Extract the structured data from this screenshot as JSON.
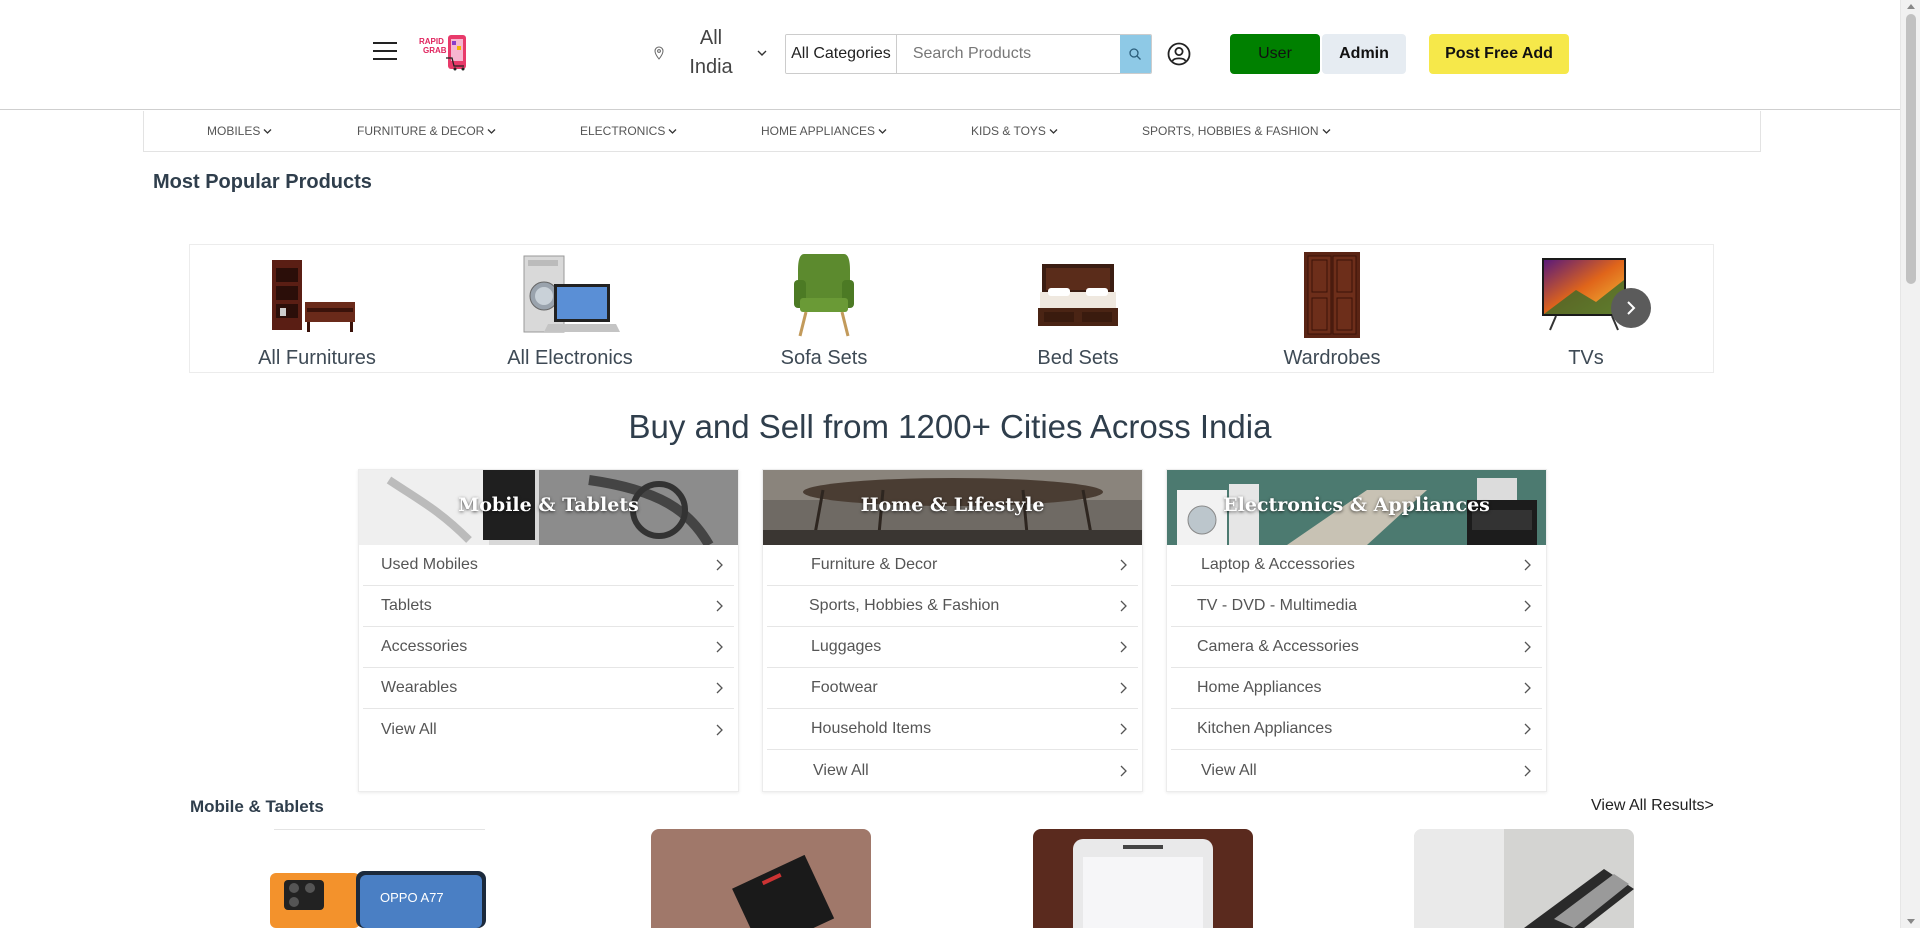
{
  "header": {
    "logo_text_1": "RAPID",
    "logo_text_2": "GRAB",
    "location": "All India",
    "category_select": "All Categories",
    "search_placeholder": "Search Products",
    "user_label": "User",
    "admin_label": "Admin",
    "post_label": "Post Free Add"
  },
  "nav": [
    {
      "label": "MOBILES"
    },
    {
      "label": "FURNITURE & DECOR"
    },
    {
      "label": "ELECTRONICS"
    },
    {
      "label": "HOME APPLIANCES"
    },
    {
      "label": "KIDS & TOYS"
    },
    {
      "label": "SPORTS, HOBBIES & FASHION"
    }
  ],
  "popular": {
    "title": "Most Popular Products",
    "items": [
      {
        "label": "All Furnitures",
        "icon": "furniture-image"
      },
      {
        "label": "All Electronics",
        "icon": "electronics-image"
      },
      {
        "label": "Sofa Sets",
        "icon": "sofa-image"
      },
      {
        "label": "Bed Sets",
        "icon": "bed-image"
      },
      {
        "label": "Wardrobes",
        "icon": "wardrobe-image"
      },
      {
        "label": "TVs",
        "icon": "tv-image"
      }
    ]
  },
  "headline": "Buy and Sell from 1200+ Cities Across India",
  "cards": [
    {
      "title": "Mobile & Tablets",
      "rows": [
        "Used Mobiles",
        "Tablets",
        "Accessories",
        "Wearables",
        "View All"
      ]
    },
    {
      "title": "Home & Lifestyle",
      "rows": [
        "Furniture & Decor",
        "Sports, Hobbies & Fashion",
        "Luggages",
        "Footwear",
        "Household Items",
        "View All"
      ]
    },
    {
      "title": "Electronics & Appliances",
      "rows": [
        "Laptop & Accessories",
        "TV - DVD - Multimedia",
        "Camera & Accessories",
        "Home Appliances",
        "Kitchen Appliances",
        "View All"
      ]
    }
  ],
  "section": {
    "title": "Mobile & Tablets",
    "view_all": "View All Results>",
    "phone_brand_text": "OPPO A77"
  },
  "colors": {
    "user_button": "#008000",
    "post_button": "#f6e84a",
    "search_button": "#8ec9e6",
    "heading": "#2f3e4c"
  }
}
